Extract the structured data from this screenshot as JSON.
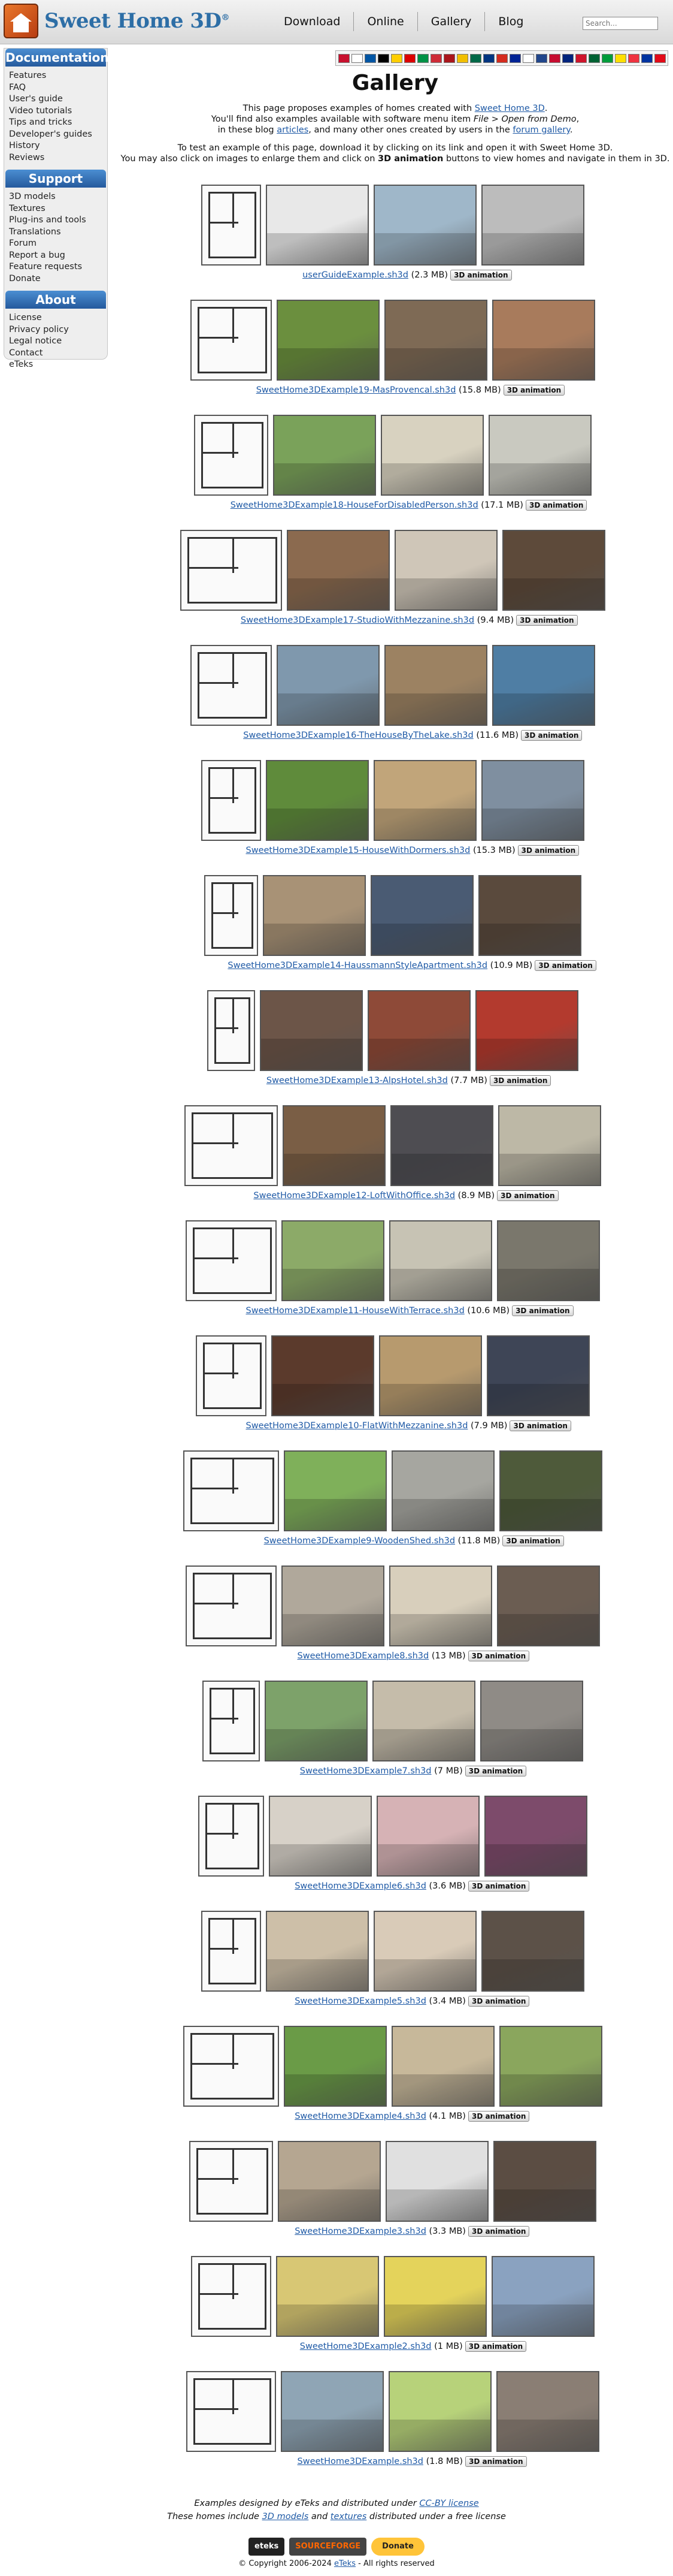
{
  "header": {
    "logo_text": "Sweet Home 3D",
    "logo_reg": "®",
    "nav": [
      "Download",
      "Online",
      "Gallery",
      "Blog"
    ],
    "search_placeholder": "Search...",
    "flag_colors": [
      "#c8102e",
      "#ffffff",
      "#0055a4",
      "#000000",
      "#ffce00",
      "#dd0000",
      "#009246",
      "#ce2b37",
      "#aa151b",
      "#f1bf00",
      "#006847",
      "#003580",
      "#d52b1e",
      "#002395",
      "#ffffff",
      "#21468b",
      "#c60c30",
      "#00247d",
      "#cf142b",
      "#006233",
      "#009c3b",
      "#ffdf00",
      "#ef3340",
      "#0033a0",
      "#e30a17"
    ]
  },
  "sidebar": {
    "documentation": {
      "title": "Documentation",
      "items": [
        "Features",
        "FAQ",
        "User's guide",
        "Video tutorials",
        "Tips and tricks",
        "Developer's guides",
        "History",
        "Reviews"
      ]
    },
    "support": {
      "title": "Support",
      "items": [
        "3D models",
        "Textures",
        "Plug-ins and tools",
        "Translations",
        "Forum",
        "Report a bug",
        "Feature requests",
        "Donate"
      ]
    },
    "about": {
      "title": "About",
      "items": [
        "License",
        "Privacy policy",
        "Legal notice",
        "Contact",
        "eTeks"
      ]
    }
  },
  "main": {
    "title": "Gallery",
    "intro1_a": "This page proposes examples of homes created with ",
    "intro1_link": "Sweet Home 3D",
    "intro1_b": ".",
    "intro2_a": "You'll find also examples available with software menu item ",
    "intro2_menu": "File > Open from Demo",
    "intro2_b": ",",
    "intro3_a": "in these blog ",
    "intro3_link": "articles",
    "intro3_b": ", and many other ones created by users in the ",
    "intro3_link2": "forum gallery",
    "intro3_c": ".",
    "intro4": "To test an example of this page, download it by clicking on its link and open it with Sweet Home 3D.",
    "intro5_a": "You may also click on images to enlarge them and click on ",
    "intro5_bold": "3D animation",
    "intro5_b": " buttons to view homes and navigate in them in 3D."
  },
  "animation_label": "3D animation",
  "examples": [
    {
      "file": "userGuideExample.sh3d",
      "size": "(2.3 MB)"
    },
    {
      "file": "SweetHome3DExample19-MasProvencal.sh3d",
      "size": "(15.8 MB)"
    },
    {
      "file": "SweetHome3DExample18-HouseForDisabledPerson.sh3d",
      "size": "(17.1 MB)"
    },
    {
      "file": "SweetHome3DExample17-StudioWithMezzanine.sh3d",
      "size": "(9.4 MB)"
    },
    {
      "file": "SweetHome3DExample16-TheHouseByTheLake.sh3d",
      "size": "(11.6 MB)"
    },
    {
      "file": "SweetHome3DExample15-HouseWithDormers.sh3d",
      "size": "(15.3 MB)"
    },
    {
      "file": "SweetHome3DExample14-HaussmannStyleApartment.sh3d",
      "size": "(10.9 MB)"
    },
    {
      "file": "SweetHome3DExample13-AlpsHotel.sh3d",
      "size": "(7.7 MB)"
    },
    {
      "file": "SweetHome3DExample12-LoftWithOffice.sh3d",
      "size": "(8.9 MB)"
    },
    {
      "file": "SweetHome3DExample11-HouseWithTerrace.sh3d",
      "size": "(10.6 MB)"
    },
    {
      "file": "SweetHome3DExample10-FlatWithMezzanine.sh3d",
      "size": "(7.9 MB)"
    },
    {
      "file": "SweetHome3DExample9-WoodenShed.sh3d",
      "size": "(11.8 MB)"
    },
    {
      "file": "SweetHome3DExample8.sh3d",
      "size": "(13 MB)"
    },
    {
      "file": "SweetHome3DExample7.sh3d",
      "size": "(7 MB)"
    },
    {
      "file": "SweetHome3DExample6.sh3d",
      "size": "(3.6 MB)"
    },
    {
      "file": "SweetHome3DExample5.sh3d",
      "size": "(3.4 MB)"
    },
    {
      "file": "SweetHome3DExample4.sh3d",
      "size": "(4.1 MB)"
    },
    {
      "file": "SweetHome3DExample3.sh3d",
      "size": "(3.3 MB)"
    },
    {
      "file": "SweetHome3DExample2.sh3d",
      "size": "(1 MB)"
    },
    {
      "file": "SweetHome3DExample.sh3d",
      "size": "(1.8 MB)"
    }
  ],
  "footer": {
    "line1_a": "Examples designed by eTeks and distributed under ",
    "line1_link": "CC-BY license",
    "line2_a": "These homes include ",
    "line2_link1": "3D models",
    "line2_b": " and ",
    "line2_link2": "textures",
    "line2_c": " distributed under a free license",
    "badge_eteks": "eteks",
    "badge_sourceforge": "SOURCEFORGE",
    "badge_donate": "Donate",
    "copyright_a": "© Copyright 2006-2024 ",
    "copyright_link": "eTeks",
    "copyright_b": " - All rights reserved"
  }
}
